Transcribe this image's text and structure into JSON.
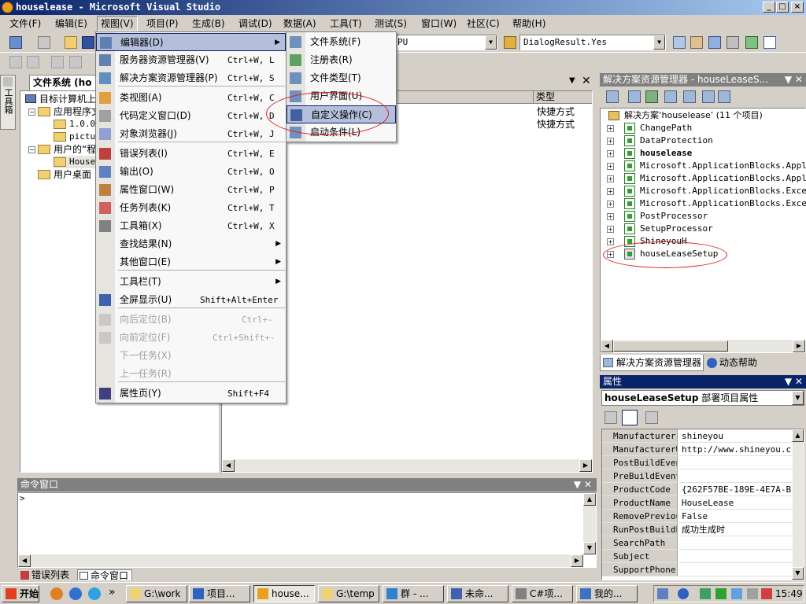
{
  "window": {
    "title": "houselease - Microsoft Visual Studio",
    "min": "_",
    "max": "□",
    "close": "×"
  },
  "menubar": [
    "文件(F)",
    "编辑(E)",
    "视图(V)",
    "项目(P)",
    "生成(B)",
    "调试(D)",
    "数据(A)",
    "工具(T)",
    "测试(S)",
    "窗口(W)",
    "社区(C)",
    "帮助(H)"
  ],
  "toolbar": {
    "config_combo": "PU",
    "dialog_combo": "DialogResult.Yes"
  },
  "left_strip": {
    "toolbox_label": "工具箱"
  },
  "file_system": {
    "tab_label": "文件系统 (ho",
    "nodes": [
      "目标计算机上",
      "应用程序文",
      "1.0.0.",
      "pictur",
      "用户的“程",
      "House",
      "用户桌面"
    ],
    "col_type": "类型",
    "types": [
      "快捷方式",
      "快捷方式"
    ]
  },
  "view_menu": {
    "items": [
      {
        "label": "编辑器(D)",
        "shortcut": "",
        "submenu": true,
        "highlight": true,
        "disabled": false
      },
      {
        "label": "服务器资源管理器(V)",
        "shortcut": "Ctrl+W, L"
      },
      {
        "label": "解决方案资源管理器(P)",
        "shortcut": "Ctrl+W, S"
      },
      {
        "label": "类视图(A)",
        "shortcut": "Ctrl+W, C"
      },
      {
        "label": "代码定义窗口(D)",
        "shortcut": "Ctrl+W, D"
      },
      {
        "label": "对象浏览器(J)",
        "shortcut": "Ctrl+W, J"
      },
      {
        "label": "错误列表(I)",
        "shortcut": "Ctrl+W, E"
      },
      {
        "label": "输出(O)",
        "shortcut": "Ctrl+W, O"
      },
      {
        "label": "属性窗口(W)",
        "shortcut": "Ctrl+W, P"
      },
      {
        "label": "任务列表(K)",
        "shortcut": "Ctrl+W, T"
      },
      {
        "label": "工具箱(X)",
        "shortcut": "Ctrl+W, X"
      },
      {
        "label": "查找结果(N)",
        "shortcut": "",
        "submenu": true
      },
      {
        "label": "其他窗口(E)",
        "shortcut": "",
        "submenu": true
      },
      {
        "label": "工具栏(T)",
        "shortcut": "",
        "submenu": true
      },
      {
        "label": "全屏显示(U)",
        "shortcut": "Shift+Alt+Enter"
      },
      {
        "label": "向后定位(B)",
        "shortcut": "Ctrl+-",
        "disabled": true
      },
      {
        "label": "向前定位(F)",
        "shortcut": "Ctrl+Shift+-",
        "disabled": true
      },
      {
        "label": "下一任务(X)",
        "shortcut": "",
        "disabled": true
      },
      {
        "label": "上一任务(R)",
        "shortcut": "",
        "disabled": true
      },
      {
        "label": "属性页(Y)",
        "shortcut": "Shift+F4"
      }
    ]
  },
  "editor_submenu": [
    "文件系统(F)",
    "注册表(R)",
    "文件类型(T)",
    "用户界面(U)",
    "自定义操作(C)",
    "启动条件(L)"
  ],
  "solution_explorer": {
    "title": "解决方案资源管理器 - houseLeaseS...",
    "solution": "解决方案‘houselease’ (11 个项目)",
    "projects": [
      "ChangePath",
      "DataProtection",
      "houselease",
      "Microsoft.ApplicationBlocks.Applica",
      "Microsoft.ApplicationBlocks.Applica",
      "Microsoft.ApplicationBlocks.Excepti",
      "Microsoft.ApplicationBlocks.Excepti",
      "PostProcessor",
      "SetupProcessor",
      "ShineyouH",
      "houseLeaseSetup"
    ],
    "tab_solution": "解决方案资源管理器",
    "tab_help": "动态帮助"
  },
  "properties": {
    "title": "属性",
    "object": "houseLeaseSetup",
    "object_desc": "部署项目属性",
    "rows": [
      [
        "Manufacturer",
        "shineyou"
      ],
      [
        "ManufacturerUrl",
        "http://www.shineyou.c"
      ],
      [
        "PostBuildEvent",
        ""
      ],
      [
        "PreBuildEvent",
        ""
      ],
      [
        "ProductCode",
        "{262F57BE-189E-4E7A-B"
      ],
      [
        "ProductName",
        "HouseLease"
      ],
      [
        "RemovePreviousVe",
        "False"
      ],
      [
        "RunPostBuildEver",
        "成功生成时"
      ],
      [
        "SearchPath",
        ""
      ],
      [
        "Subject",
        ""
      ],
      [
        "SupportPhone",
        ""
      ]
    ]
  },
  "command_window": {
    "title": "命令窗口",
    "prompt": ">",
    "tab_errors": "错误列表",
    "tab_command": "命令窗口"
  },
  "taskbar": {
    "start": "开始",
    "tasks": [
      "G:\\work",
      "项目...",
      "house...",
      "G:\\temp",
      "群 - ...",
      "未命...",
      "C#项...",
      "我的..."
    ],
    "clock": "15:49"
  }
}
